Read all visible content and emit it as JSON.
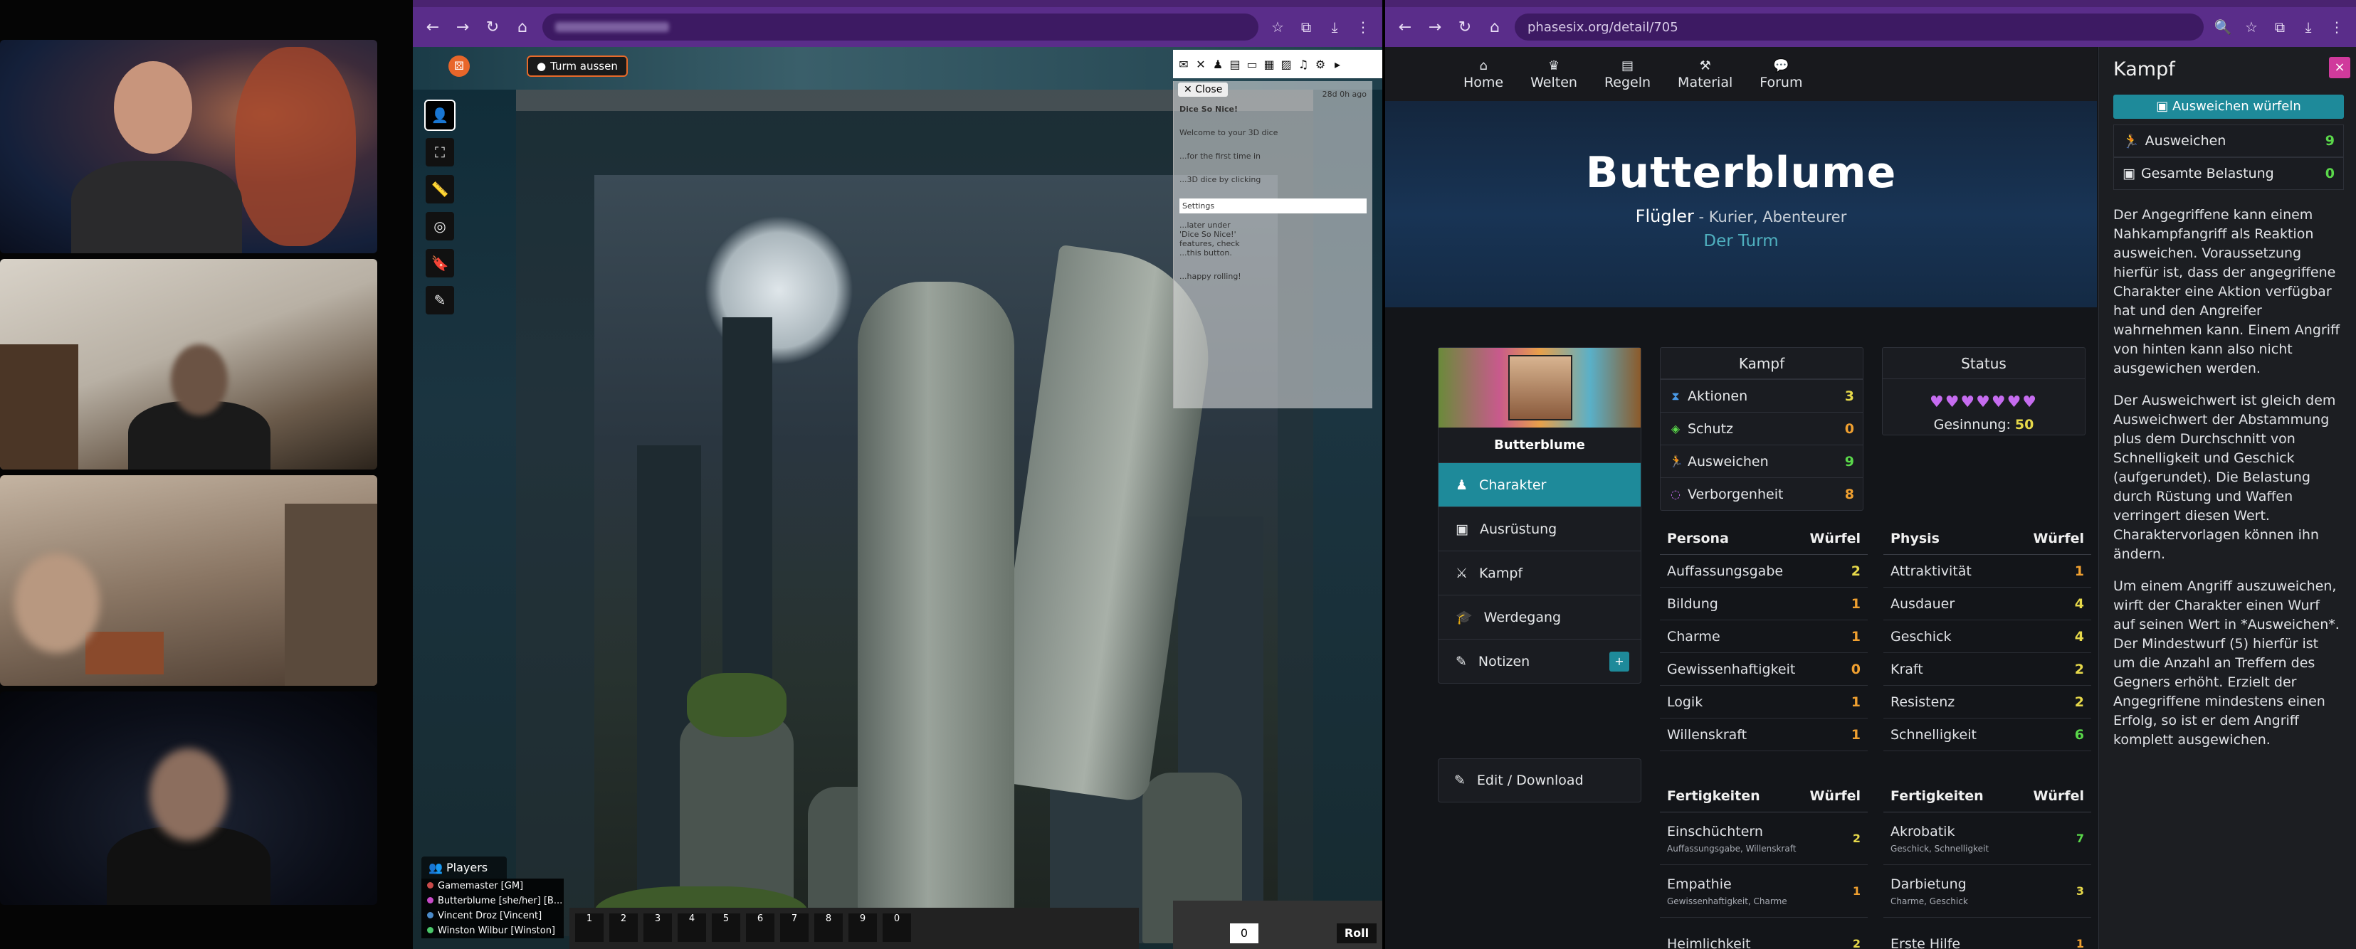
{
  "browser_left": {
    "toolbar_icons": [
      "←",
      "→",
      "↻",
      "⌂"
    ]
  },
  "browser_right": {
    "url": "phasesix.org/detail/705",
    "toolbar_icons": [
      "←",
      "→",
      "↻",
      "⌂"
    ]
  },
  "roll20": {
    "page_tab": "Turm aussen",
    "dice_panel": {
      "close_label": "✕ Close",
      "msg_time": "28d 0h ago",
      "lines": [
        "Dice So Nice!",
        "Welcome to your 3D dice",
        "...for the first time in",
        "...3D dice by clicking",
        "Settings",
        "...later under",
        "'Dice So Nice!'",
        "features, check",
        "...this button.",
        "...happy rolling!"
      ]
    },
    "players": {
      "header": "Players",
      "list": [
        {
          "name": "Gamemaster [GM]",
          "color": "#c84a4a"
        },
        {
          "name": "Butterblume [she/her] [B...",
          "color": "#c84ac8"
        },
        {
          "name": "Vincent Droz [Vincent]",
          "color": "#4a8ac8"
        },
        {
          "name": "Winston Wilbur [Winston]",
          "color": "#4ac86a"
        }
      ]
    },
    "macro_numbers": [
      "1",
      "2",
      "3",
      "4",
      "5",
      "6",
      "7",
      "8",
      "9",
      "0"
    ],
    "roll": {
      "count": "0",
      "roll_label": "Roll"
    }
  },
  "phasesix": {
    "nav": [
      {
        "icon": "⌂",
        "label": "Home"
      },
      {
        "icon": "♛",
        "label": "Welten"
      },
      {
        "icon": "▤",
        "label": "Regeln"
      },
      {
        "icon": "⚒",
        "label": "Material"
      },
      {
        "icon": "💬",
        "label": "Forum"
      }
    ],
    "hero": {
      "name": "Butterblume",
      "species": "Flügler",
      "roles": " - Kurier, Abenteurer",
      "world": "Der Turm"
    },
    "character_card": {
      "name": "Butterblume",
      "menu": [
        {
          "icon": "♟",
          "label": "Charakter"
        },
        {
          "icon": "▣",
          "label": "Ausrüstung"
        },
        {
          "icon": "⚔",
          "label": "Kampf"
        },
        {
          "icon": "🎓",
          "label": "Werdegang"
        },
        {
          "icon": "✎",
          "label": "Notizen",
          "plus": "+"
        }
      ],
      "edit_label": "Edit / Download"
    },
    "kampf_box": {
      "title": "Kampf",
      "rows": [
        {
          "icon": "⧗",
          "label": "Aktionen",
          "value": "3"
        },
        {
          "icon": "◈",
          "label": "Schutz",
          "value": "0"
        },
        {
          "icon": "🏃",
          "label": "Ausweichen",
          "value": "9"
        },
        {
          "icon": "◌",
          "label": "Verborgenheit",
          "value": "8"
        }
      ]
    },
    "status_box": {
      "title": "Status",
      "hearts": "♥♥♥♥♥♥♥",
      "gesinnung_label": "Gesinnung: ",
      "gesinnung_value": "50"
    },
    "persona": {
      "header": "Persona",
      "col": "Würfel",
      "rows": [
        {
          "label": "Auffassungsgabe",
          "value": "2"
        },
        {
          "label": "Bildung",
          "value": "1"
        },
        {
          "label": "Charme",
          "value": "1"
        },
        {
          "label": "Gewissenhaftigkeit",
          "value": "0"
        },
        {
          "label": "Logik",
          "value": "1"
        },
        {
          "label": "Willenskraft",
          "value": "1"
        }
      ]
    },
    "physis": {
      "header": "Physis",
      "col": "Würfel",
      "rows": [
        {
          "label": "Attraktivität",
          "value": "1"
        },
        {
          "label": "Ausdauer",
          "value": "4"
        },
        {
          "label": "Geschick",
          "value": "4"
        },
        {
          "label": "Kraft",
          "value": "2"
        },
        {
          "label": "Resistenz",
          "value": "2"
        },
        {
          "label": "Schnelligkeit",
          "value": "6"
        }
      ]
    },
    "fertigkeiten_left": {
      "header": "Fertigkeiten",
      "col": "Würfel",
      "rows": [
        {
          "label": "Einschüchtern",
          "sub": "Auffassungsgabe, Willenskraft",
          "value": "2"
        },
        {
          "label": "Empathie",
          "sub": "Gewissenhaftigkeit, Charme",
          "value": "1"
        },
        {
          "label": "Heimlichkeit",
          "sub": "",
          "value": "2"
        }
      ]
    },
    "fertigkeiten_right": {
      "header": "Fertigkeiten",
      "col": "Würfel",
      "rows": [
        {
          "label": "Akrobatik",
          "sub": "Geschick, Schnelligkeit",
          "value": "7"
        },
        {
          "label": "Darbietung",
          "sub": "Charme, Geschick",
          "value": "3"
        },
        {
          "label": "Erste Hilfe",
          "sub": "",
          "value": "1"
        }
      ]
    },
    "side_panel": {
      "title": "Kampf",
      "close": "×",
      "roll_button": "▣ Ausweichen würfeln",
      "rows": [
        {
          "icon": "🏃",
          "label": "Ausweichen",
          "value": "9"
        },
        {
          "icon": "▣",
          "label": "Gesamte Belastung",
          "value": "0"
        }
      ],
      "paragraphs": [
        "Der Angegriffene kann einem Nahkampfangriff als Reaktion ausweichen. Voraussetzung hierfür ist, dass der angegriffene Charakter eine Aktion verfügbar hat und den Angreifer wahrnehmen kann. Einem Angriff von hinten kann also nicht ausgewichen werden.",
        "Der Ausweichwert ist gleich dem Ausweichwert der Abstammung plus dem Durchschnitt von Schnelligkeit und Geschick (aufgerundet). Die Belastung durch Rüstung und Waffen verringert diesen Wert. Charaktervorlagen können ihn ändern.",
        "Um einem Angriff auszuweichen, wirft der Charakter einen Wurf auf seinen Wert in *Ausweichen*. Der Mindestwurf (5) hierfür ist um die Anzahl an Treffern des Gegners erhöht. Erzielt der Angegriffene mindestens einen Erfolg, so ist er dem Angriff komplett ausgewichen."
      ]
    }
  }
}
